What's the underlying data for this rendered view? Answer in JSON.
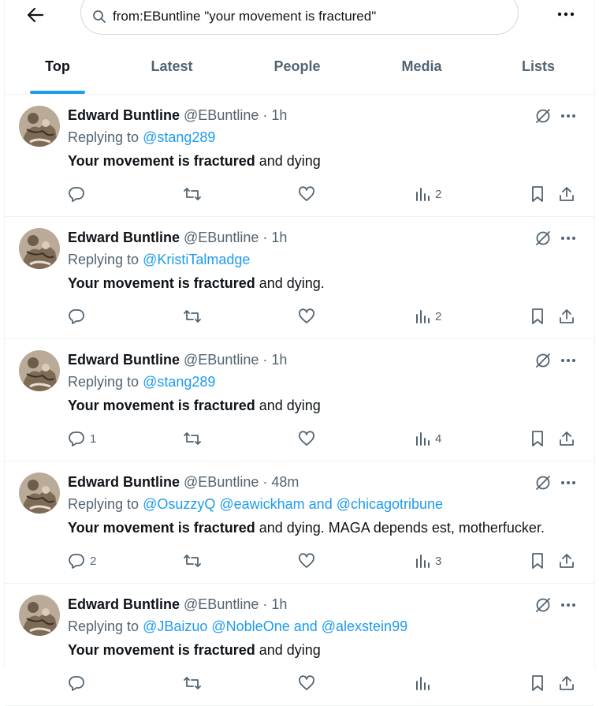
{
  "header": {
    "search_query": "from:EBuntline \"your movement is fractured\""
  },
  "tabs": [
    {
      "label": "Top"
    },
    {
      "label": "Latest"
    },
    {
      "label": "People"
    },
    {
      "label": "Media"
    },
    {
      "label": "Lists"
    }
  ],
  "tweets": [
    {
      "name": "Edward Buntline",
      "handle": "@EBuntline",
      "time": "1h",
      "replying_prefix": "Replying to",
      "replying_to": "@stang289",
      "bold_text": "Your movement is fractured",
      "rest_text": " and dying",
      "replies": "",
      "views": "2"
    },
    {
      "name": "Edward Buntline",
      "handle": "@EBuntline",
      "time": "1h",
      "replying_prefix": "Replying to",
      "replying_to": "@KristiTalmadge",
      "bold_text": "Your movement is fractured",
      "rest_text": " and dying.",
      "replies": "",
      "views": "2"
    },
    {
      "name": "Edward Buntline",
      "handle": "@EBuntline",
      "time": "1h",
      "replying_prefix": "Replying to",
      "replying_to": "@stang289",
      "bold_text": "Your movement is fractured",
      "rest_text": " and dying",
      "replies": "1",
      "views": "4"
    },
    {
      "name": "Edward Buntline",
      "handle": "@EBuntline",
      "time": "48m",
      "replying_prefix": "Replying to",
      "replying_to": "@OsuzzyQ @eawickham and @chicagotribune",
      "bold_text": "Your movement is fractured",
      "rest_text": " and dying. MAGA depends est, motherfucker.",
      "replies": "2",
      "views": "3"
    },
    {
      "name": "Edward Buntline",
      "handle": "@EBuntline",
      "time": "1h",
      "replying_prefix": "Replying to",
      "replying_to": "@JBaizuo @NobleOne and @alexstein99",
      "bold_text": "Your movement is fractured",
      "rest_text": " and dying",
      "replies": "",
      "views": ""
    }
  ],
  "colors": {
    "accent": "#1d9bf0",
    "secondary_text": "#536471",
    "primary_text": "#0f1419",
    "border": "#eff3f4"
  },
  "icons": [
    "back-arrow-icon",
    "search-icon",
    "more-icon",
    "grok-icon",
    "reply-icon",
    "retweet-icon",
    "like-icon",
    "views-icon",
    "bookmark-icon",
    "share-icon"
  ]
}
